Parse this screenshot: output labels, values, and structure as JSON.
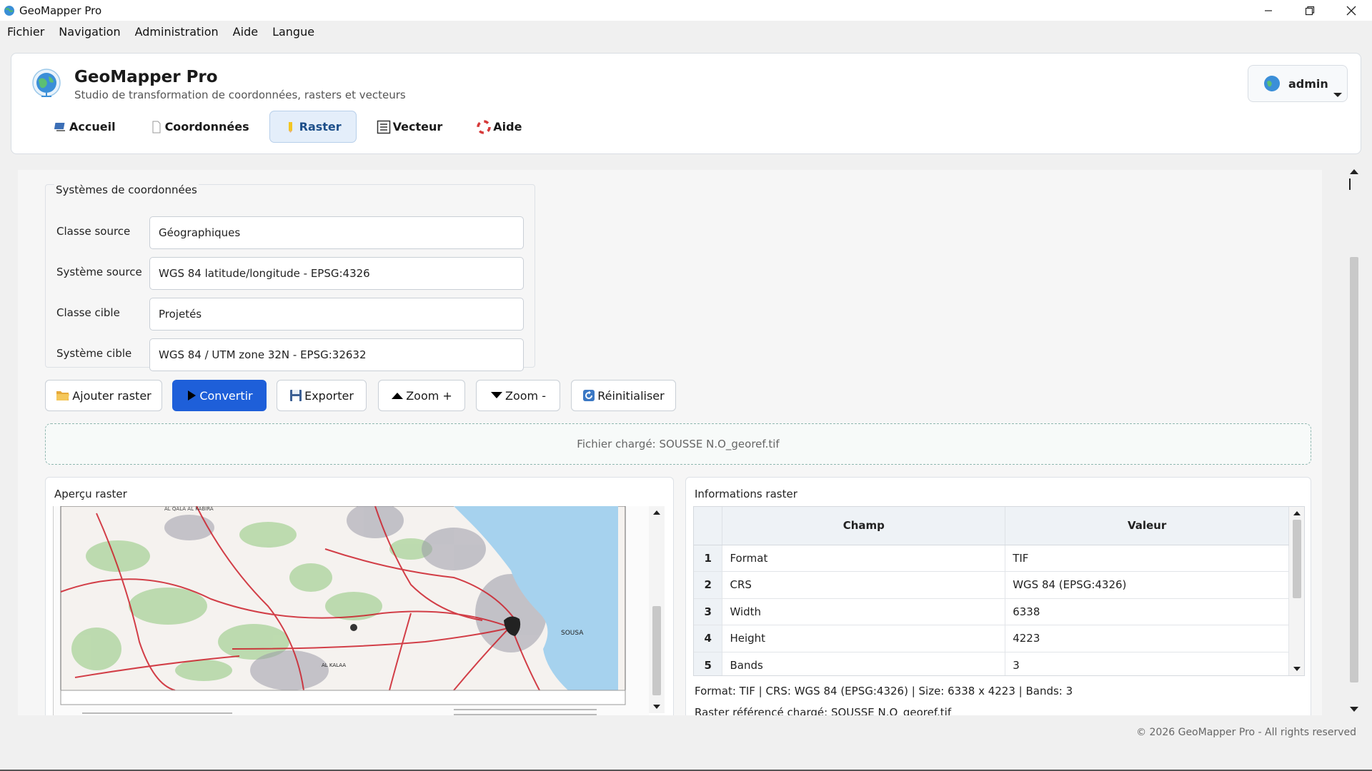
{
  "window": {
    "title": "GeoMapper Pro"
  },
  "menu": [
    "Fichier",
    "Navigation",
    "Administration",
    "Aide",
    "Langue"
  ],
  "header": {
    "app_name": "GeoMapper Pro",
    "subtitle": "Studio de transformation de coordonnées, rasters et vecteurs",
    "user": "admin"
  },
  "tabs": [
    {
      "label": "Accueil",
      "icon": "monitor-icon"
    },
    {
      "label": "Coordonnées",
      "icon": "document-icon"
    },
    {
      "label": "Raster",
      "icon": "pencil-icon",
      "active": true
    },
    {
      "label": "Vecteur",
      "icon": "list-icon"
    },
    {
      "label": "Aide",
      "icon": "lifebuoy-icon"
    }
  ],
  "crs_group": {
    "title": "Systèmes de coordonnées",
    "rows": [
      {
        "label": "Classe source",
        "value": "Géographiques"
      },
      {
        "label": "Système source",
        "value": "WGS 84 latitude/longitude - EPSG:4326"
      },
      {
        "label": "Classe cible",
        "value": "Projetés"
      },
      {
        "label": "Système cible",
        "value": "WGS 84 / UTM zone 32N - EPSG:32632"
      }
    ]
  },
  "actions": {
    "add": "Ajouter raster",
    "convert": "Convertir",
    "export": "Exporter",
    "zoom_in": "Zoom +",
    "zoom_out": "Zoom -",
    "reset": "Réinitialiser"
  },
  "loaded_file": "Fichier chargé: SOUSSE N.O_georef.tif",
  "preview": {
    "title": "Aperçu raster",
    "map_labels": [
      "SOUSA",
      "AL QALA AL KABIRA",
      "AL KALAA"
    ]
  },
  "info": {
    "title": "Informations raster",
    "columns": [
      "Champ",
      "Valeur"
    ],
    "rows": [
      {
        "n": "1",
        "field": "Format",
        "value": "TIF"
      },
      {
        "n": "2",
        "field": "CRS",
        "value": "WGS 84 (EPSG:4326)"
      },
      {
        "n": "3",
        "field": "Width",
        "value": "6338"
      },
      {
        "n": "4",
        "field": "Height",
        "value": "4223"
      },
      {
        "n": "5",
        "field": "Bands",
        "value": "3"
      }
    ],
    "summary": "Format: TIF | CRS: WGS 84 (EPSG:4326) | Size: 6338 x 4223 | Bands: 3",
    "log": "Raster référencé chargé: SOUSSE N.O_georef.tif"
  },
  "footer": "© 2026 GeoMapper Pro - All rights reserved",
  "colors": {
    "primary": "#1e5fd9",
    "active_tab_bg": "#e4eefa",
    "sea": "#a6d2ee",
    "roads": "#cc1f2a"
  }
}
